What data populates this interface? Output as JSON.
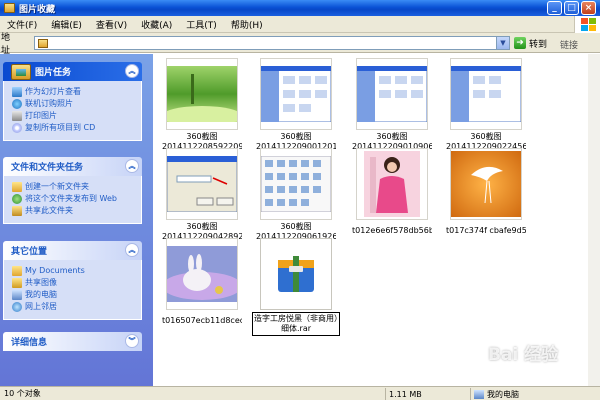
{
  "window": {
    "title": "图片收藏"
  },
  "menu": [
    "文件(F)",
    "编辑(E)",
    "查看(V)",
    "收藏(A)",
    "工具(T)",
    "帮助(H)"
  ],
  "address": {
    "label": "地址",
    "go_label": "转到",
    "links_label": "链接"
  },
  "panels": {
    "picture_tasks": {
      "title": "图片任务",
      "items": [
        "作为幻灯片查看",
        "联机订购照片",
        "打印图片",
        "复制所有项目到 CD"
      ]
    },
    "file_tasks": {
      "title": "文件和文件夹任务",
      "items": [
        "创建一个新文件夹",
        "将这个文件夹发布到 Web",
        "共享此文件夹"
      ]
    },
    "other_places": {
      "title": "其它位置",
      "items": [
        "My Documents",
        "共享图像",
        "我的电脑",
        "网上邻居"
      ]
    },
    "details": {
      "title": "详细信息"
    }
  },
  "files": [
    {
      "name1": "360截图",
      "name2": "20141122085922093...",
      "thumb": "green-landscape"
    },
    {
      "name1": "360截图",
      "name2": "20141122090012015...",
      "thumb": "explorer-window"
    },
    {
      "name1": "360截图",
      "name2": "20141122090109062...",
      "thumb": "explorer-window"
    },
    {
      "name1": "360截图",
      "name2": "20141122090224562...",
      "thumb": "explorer-window"
    },
    {
      "name1": "360截图",
      "name2": "20141122090428921...",
      "thumb": "dialog-window"
    },
    {
      "name1": "360截图",
      "name2": "20141122090619265...",
      "thumb": "icon-grid"
    },
    {
      "name1": "t012e6e6f578db56b...",
      "name2": "",
      "thumb": "girl-photo"
    },
    {
      "name1": "t017c374f cbafe9d5...",
      "name2": "",
      "thumb": "egret-photo"
    },
    {
      "name1": "t016507ecb11d8cec...",
      "name2": "",
      "thumb": "rabbit-photo"
    },
    {
      "name1": "造字工房悦黑（非商用）细体.rar",
      "name2": "",
      "thumb": "rar-archive"
    }
  ],
  "status": {
    "count": "10 个对象",
    "size": "1.11 MB",
    "location": "我的电脑"
  },
  "watermark": "Bai 经验",
  "colors": {
    "title_blue": "#0a52d6",
    "task_link": "#215dc6",
    "pane_bg": "#7ba2e7"
  }
}
